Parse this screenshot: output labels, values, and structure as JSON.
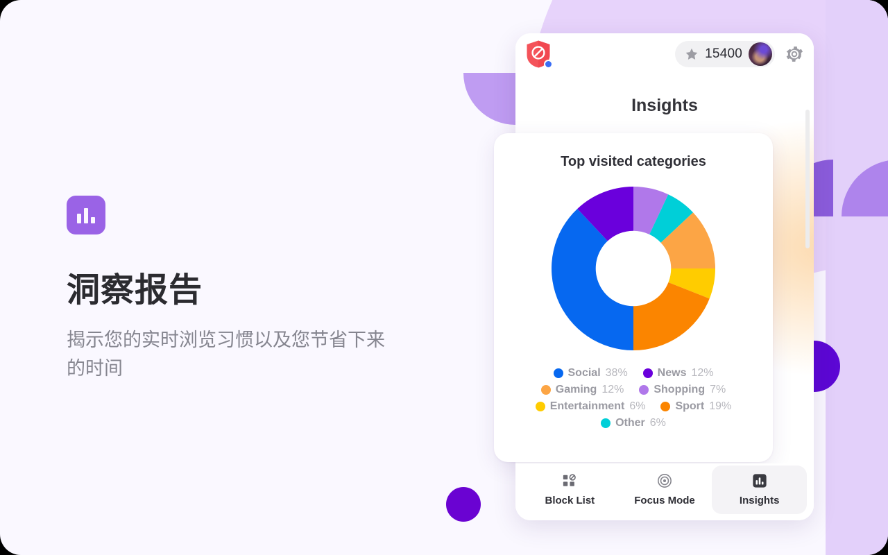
{
  "hero": {
    "badge_icon": "bar-chart-icon",
    "title": "洞察报告",
    "subtitle": "揭示您的实时浏览习惯以及您节省下来的时间",
    "badge_color": "#9a63e6"
  },
  "app": {
    "logo_icon": "blocked-shield-icon",
    "logo_badge_color": "#3b6ef5",
    "score": {
      "icon": "star-icon",
      "value": "15400"
    },
    "avatar_icon": "user-avatar",
    "settings_icon": "gear-icon",
    "page_title": "Insights",
    "scrollbar": "vertical-scrollbar"
  },
  "card": {
    "title": "Top visited categories"
  },
  "chart_data": {
    "type": "pie",
    "title": "Top visited categories",
    "subtype": "donut",
    "start_angle_deg": 0,
    "direction": "clockwise",
    "inner_radius_ratio": 0.46,
    "legend_position": "bottom",
    "grid": false,
    "categories": [
      "Shopping",
      "Other",
      "Gaming",
      "Entertainment",
      "Sport",
      "Social",
      "News"
    ],
    "values": [
      7,
      6,
      12,
      6,
      19,
      38,
      12
    ],
    "labels": [
      "7%",
      "6%",
      "12%",
      "6%",
      "19%",
      "38%",
      "12%"
    ],
    "colors": [
      "#b078ea",
      "#00cfd8",
      "#fca545",
      "#ffcc00",
      "#fb8500",
      "#0668f0",
      "#6a00dc"
    ],
    "legend_order": [
      {
        "label": "Social",
        "pct": "38%",
        "color": "#0668f0"
      },
      {
        "label": "News",
        "pct": "12%",
        "color": "#6a00dc"
      },
      {
        "label": "Gaming",
        "pct": "12%",
        "color": "#fca545"
      },
      {
        "label": "Shopping",
        "pct": "7%",
        "color": "#b078ea"
      },
      {
        "label": "Entertainment",
        "pct": "6%",
        "color": "#ffcc00"
      },
      {
        "label": "Sport",
        "pct": "19%",
        "color": "#fb8500"
      },
      {
        "label": "Other",
        "pct": "6%",
        "color": "#00cfd8"
      }
    ]
  },
  "nav": {
    "items": [
      {
        "label": "Block List",
        "icon": "block-list-icon",
        "active": false
      },
      {
        "label": "Focus Mode",
        "icon": "target-icon",
        "active": false
      },
      {
        "label": "Insights",
        "icon": "bar-chart-icon",
        "active": true
      }
    ]
  },
  "theme": {
    "page_background": "#faf8ff",
    "decor_light_purple": "#e7d3fb",
    "decor_mid_purple": "#bf9cf2",
    "decor_deep_purple": "#5c07d4"
  }
}
